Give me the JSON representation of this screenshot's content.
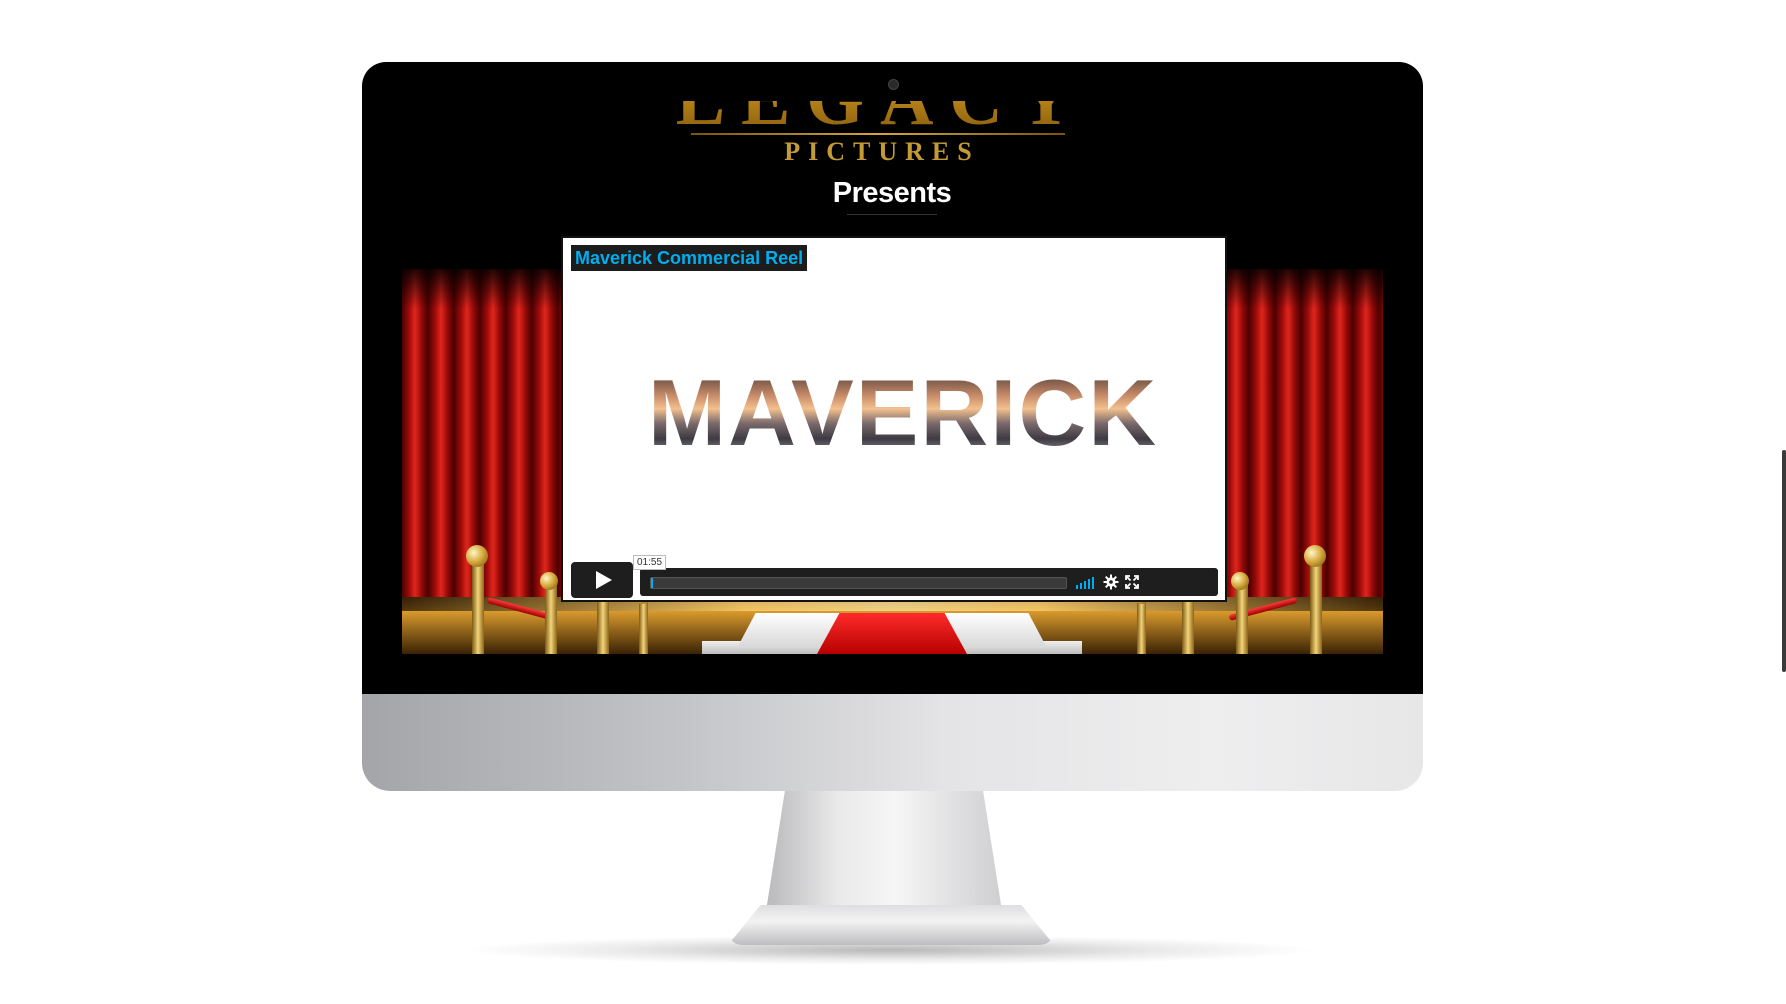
{
  "logo": {
    "brand_text": "LEGACY",
    "brand_subtext": "PICTURES"
  },
  "page": {
    "presents_text": "Presents"
  },
  "video": {
    "title": "Maverick Commercial Reel",
    "poster_text": "MAVERICK",
    "time_tooltip": "01:55",
    "progress_fraction": 0.004,
    "volume_level": 1.0
  },
  "colors": {
    "accent": "#00adef",
    "player_bar": "#1e1e1e",
    "logo_gold": "#c49a36"
  },
  "icons": {
    "play": "play-icon",
    "volume": "volume-icon",
    "settings": "gear-icon",
    "fullscreen": "fullscreen-icon"
  }
}
